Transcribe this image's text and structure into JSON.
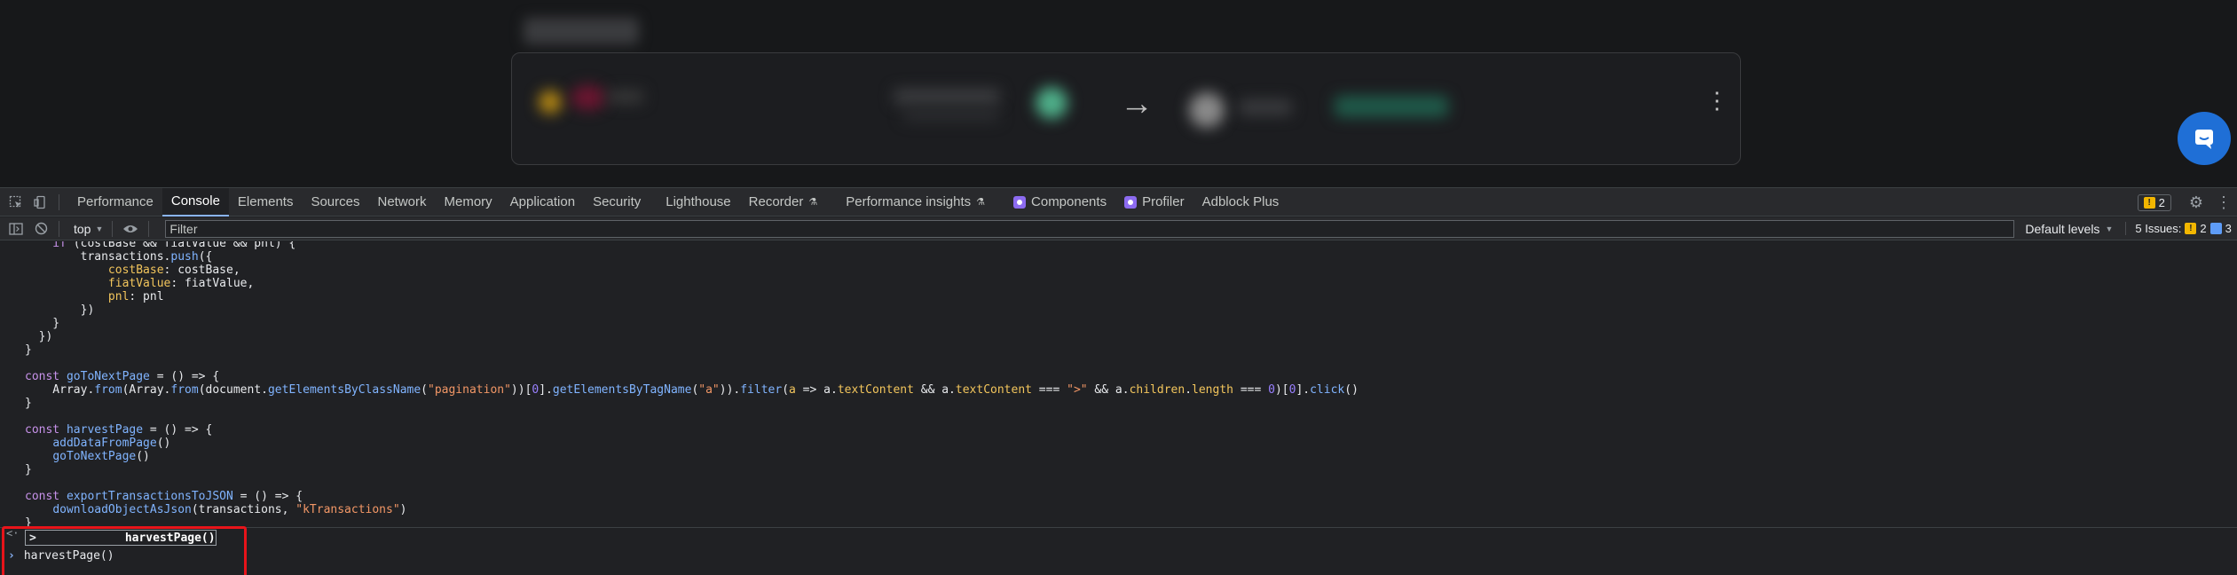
{
  "devtools": {
    "tabs": [
      {
        "label": "Performance"
      },
      {
        "label": "Console",
        "active": true
      },
      {
        "label": "Elements"
      },
      {
        "label": "Sources"
      },
      {
        "label": "Network"
      },
      {
        "label": "Memory"
      },
      {
        "label": "Application"
      },
      {
        "label": "Security"
      },
      {
        "label": "Lighthouse"
      },
      {
        "label": "Recorder",
        "experimental": true
      },
      {
        "label": "Performance insights",
        "experimental": true
      },
      {
        "label": "Components",
        "react": true
      },
      {
        "label": "Profiler",
        "react": true
      },
      {
        "label": "Adblock Plus"
      }
    ],
    "warning_count": "2",
    "toolbar": {
      "context": "top",
      "filter_placeholder": "Filter",
      "levels_label": "Default levels",
      "issues_label": "5 Issues:",
      "issues_warn": "2",
      "issues_info": "3"
    },
    "console": {
      "autocomplete_chevron": ">",
      "autocomplete_text": "harvestPage()",
      "prompt_text": "harvestPage()"
    }
  },
  "colors": {
    "accent_blue": "#8ab4f8",
    "highlight_red": "#e8141a",
    "chat_blue": "#1f6fd6"
  }
}
